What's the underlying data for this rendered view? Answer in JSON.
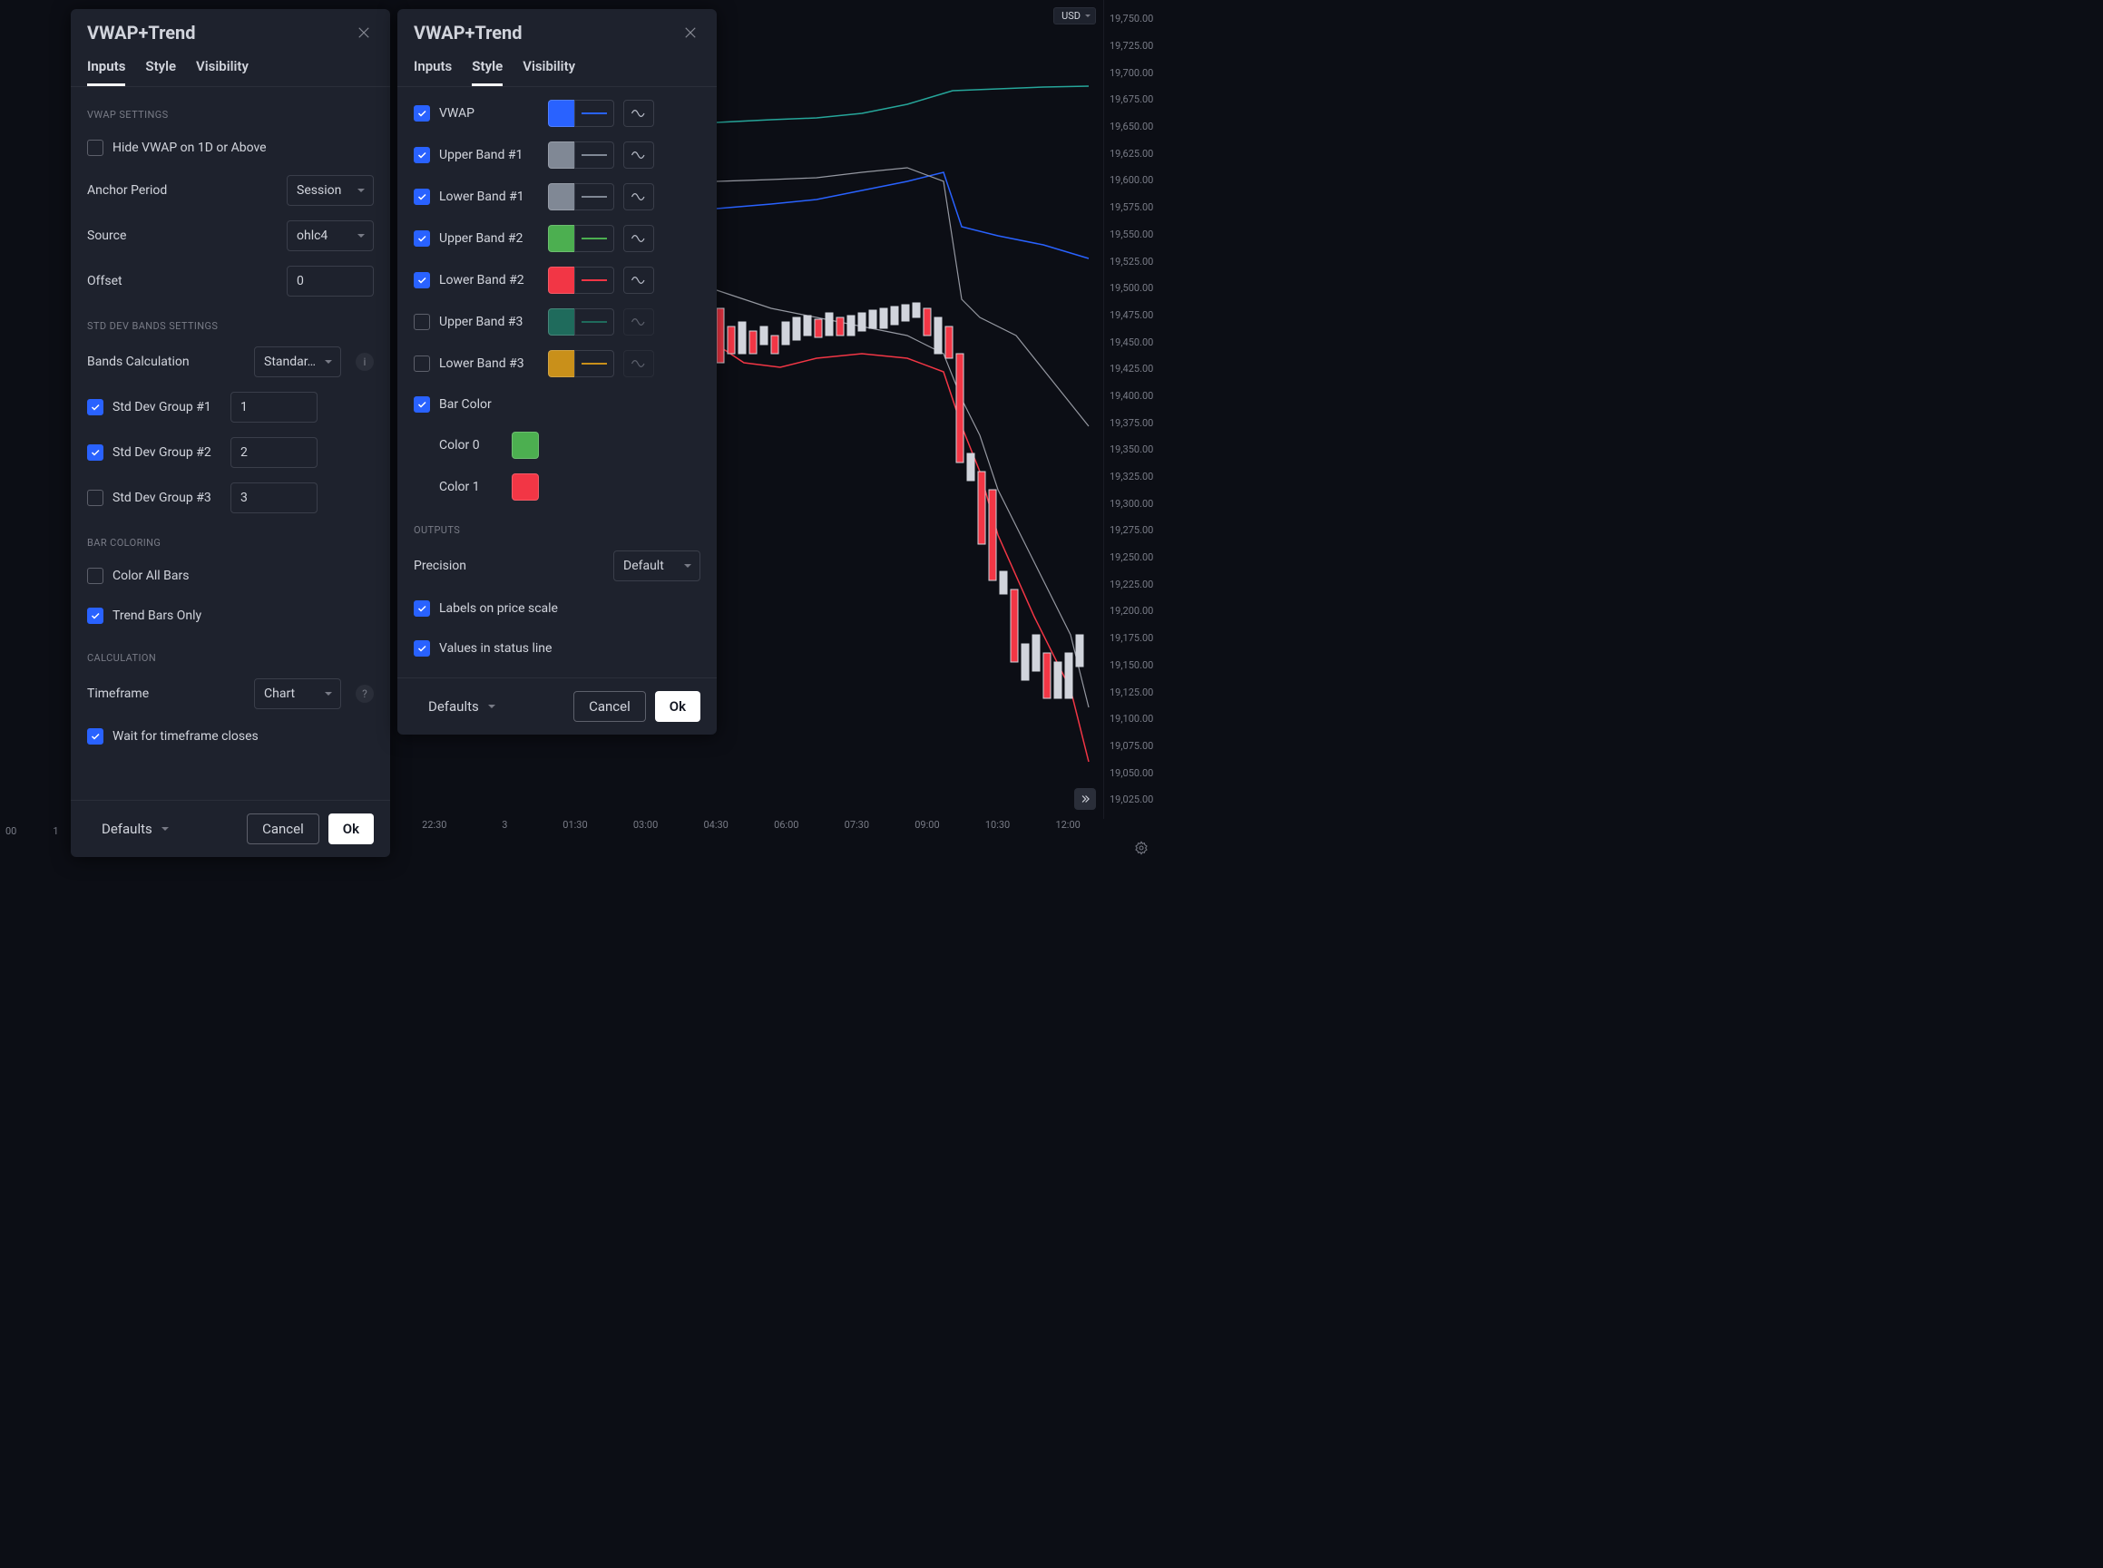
{
  "currency": "USD",
  "dialog_title": "VWAP+Trend",
  "tabs": {
    "inputs": "Inputs",
    "style": "Style",
    "visibility": "Visibility"
  },
  "inputs_panel": {
    "sections": {
      "vwap": "VWAP SETTINGS",
      "std": "STD DEV BANDS SETTINGS",
      "bar": "BAR COLORING",
      "calc": "CALCULATION"
    },
    "hide_vwap": {
      "label": "Hide VWAP on 1D or Above",
      "checked": false
    },
    "anchor": {
      "label": "Anchor Period",
      "value": "Session"
    },
    "source": {
      "label": "Source",
      "value": "ohlc4"
    },
    "offset": {
      "label": "Offset",
      "value": "0"
    },
    "bands_calc": {
      "label": "Bands Calculation",
      "value": "Standar…"
    },
    "std1": {
      "label": "Std Dev Group #1",
      "checked": true,
      "value": "1"
    },
    "std2": {
      "label": "Std Dev Group #2",
      "checked": true,
      "value": "2"
    },
    "std3": {
      "label": "Std Dev Group #3",
      "checked": false,
      "value": "3"
    },
    "color_all": {
      "label": "Color All Bars",
      "checked": false
    },
    "trend_only": {
      "label": "Trend Bars Only",
      "checked": true
    },
    "timeframe": {
      "label": "Timeframe",
      "value": "Chart"
    },
    "wait": {
      "label": "Wait for timeframe closes",
      "checked": true
    }
  },
  "style_panel": {
    "items": [
      {
        "key": "vwap",
        "label": "VWAP",
        "checked": true,
        "color": "#2962ff",
        "line": "#2962ff",
        "dd": true
      },
      {
        "key": "ub1",
        "label": "Upper Band #1",
        "checked": true,
        "color": "#808895",
        "line": "#808895",
        "dd": true
      },
      {
        "key": "lb1",
        "label": "Lower Band #1",
        "checked": true,
        "color": "#808895",
        "line": "#808895",
        "dd": true
      },
      {
        "key": "ub2",
        "label": "Upper Band #2",
        "checked": true,
        "color": "#4caf50",
        "line": "#4caf50",
        "dd": true
      },
      {
        "key": "lb2",
        "label": "Lower Band #2",
        "checked": true,
        "color": "#f23645",
        "line": "#f23645",
        "dd": true
      },
      {
        "key": "ub3",
        "label": "Upper Band #3",
        "checked": false,
        "color": "#1f6b5c",
        "line": "#1f6b5c",
        "dd": false
      },
      {
        "key": "lb3",
        "label": "Lower Band #3",
        "checked": false,
        "color": "#c9901a",
        "line": "#c9901a",
        "dd": false
      }
    ],
    "bar_color": {
      "label": "Bar Color",
      "checked": true,
      "color0_label": "Color 0",
      "color0": "#4caf50",
      "color1_label": "Color 1",
      "color1": "#f23645"
    },
    "outputs_title": "OUTPUTS",
    "precision": {
      "label": "Precision",
      "value": "Default"
    },
    "labels_price": {
      "label": "Labels on price scale",
      "checked": true
    },
    "values_status": {
      "label": "Values in status line",
      "checked": true
    }
  },
  "footer": {
    "defaults": "Defaults",
    "cancel": "Cancel",
    "ok": "Ok"
  },
  "price_ticks": [
    "19,750.00",
    "19,725.00",
    "19,700.00",
    "19,675.00",
    "19,650.00",
    "19,625.00",
    "19,600.00",
    "19,575.00",
    "19,550.00",
    "19,525.00",
    "19,500.00",
    "19,475.00",
    "19,450.00",
    "19,425.00",
    "19,400.00",
    "19,375.00",
    "19,350.00",
    "19,325.00",
    "19,300.00",
    "19,275.00",
    "19,250.00",
    "19,225.00",
    "19,200.00",
    "19,175.00",
    "19,150.00",
    "19,125.00",
    "19,100.00",
    "19,075.00",
    "19,050.00",
    "19,025.00"
  ],
  "time_ticks": [
    "22:30",
    "3",
    "01:30",
    "03:00",
    "04:30",
    "06:00",
    "07:30",
    "09:00",
    "10:30",
    "12:00"
  ],
  "left_time": [
    "00",
    "1"
  ]
}
